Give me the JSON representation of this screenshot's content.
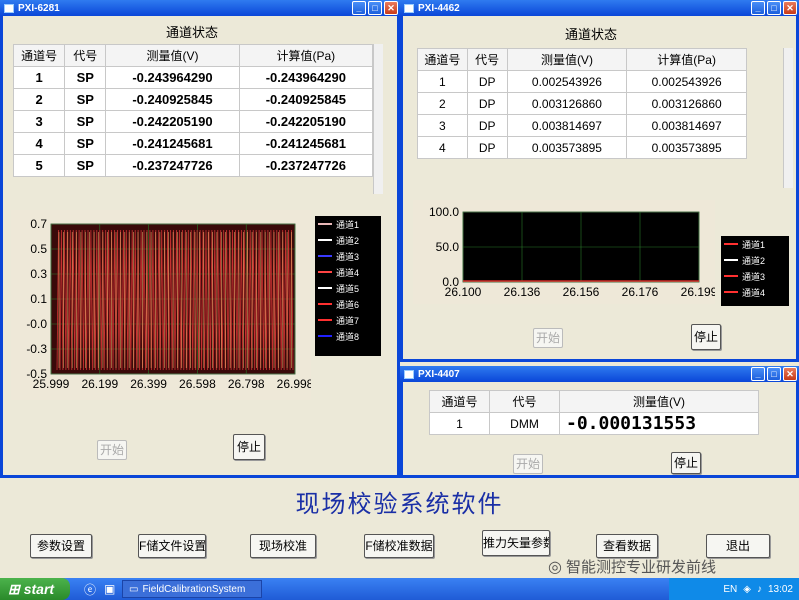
{
  "window1": {
    "title": "PXI-6281",
    "panel_title": "通道状态",
    "columns": [
      "通道号",
      "代号",
      "测量值(V)",
      "计算值(Pa)"
    ],
    "rows": [
      [
        "1",
        "SP",
        "-0.243964290",
        "-0.243964290"
      ],
      [
        "2",
        "SP",
        "-0.240925845",
        "-0.240925845"
      ],
      [
        "3",
        "SP",
        "-0.242205190",
        "-0.242205190"
      ],
      [
        "4",
        "SP",
        "-0.241245681",
        "-0.241245681"
      ],
      [
        "5",
        "SP",
        "-0.237247726",
        "-0.237247726"
      ]
    ],
    "start_label": "开始",
    "stop_label": "停止"
  },
  "window2": {
    "title": "PXI-4462",
    "panel_title": "通道状态",
    "columns": [
      "通道号",
      "代号",
      "测量值(V)",
      "计算值(Pa)"
    ],
    "rows": [
      [
        "1",
        "DP",
        "0.002543926",
        "0.002543926"
      ],
      [
        "2",
        "DP",
        "0.003126860",
        "0.003126860"
      ],
      [
        "3",
        "DP",
        "0.003814697",
        "0.003814697"
      ],
      [
        "4",
        "DP",
        "0.003573895",
        "0.003573895"
      ]
    ],
    "start_label": "开始",
    "stop_label": "停止"
  },
  "window3": {
    "title": "PXI-4407",
    "columns": [
      "通道号",
      "代号",
      "测量值(V)"
    ],
    "row": [
      "1",
      "DMM",
      "-0.000131553"
    ],
    "start_label": "开始",
    "stop_label": "停止"
  },
  "chart_data": [
    {
      "type": "line",
      "x_ticks": [
        "25.999",
        "26.199",
        "26.399",
        "26.598",
        "26.798",
        "26.998"
      ],
      "y_ticks": [
        "0.7",
        "0.5",
        "0.3",
        "0.1",
        "-0.0",
        "-0.3",
        "-0.5"
      ],
      "ylim": [
        -0.55,
        0.75
      ],
      "legend": [
        "通道1",
        "通道2",
        "通道3",
        "通道4",
        "通道5",
        "通道6",
        "通道7",
        "通道8"
      ],
      "legend_colors": [
        "#e8b8b8",
        "#ffffff",
        "#3a3aff",
        "#ff4444",
        "#ffffff",
        "#ff3030",
        "#ff3030",
        "#2020ff"
      ],
      "plot_bg": "#3a0a0a"
    },
    {
      "type": "line",
      "x_ticks": [
        "26.100",
        "26.136",
        "26.156",
        "26.176",
        "26.199"
      ],
      "y_ticks": [
        "100.0",
        "50.0",
        "0.0"
      ],
      "ylim": [
        0,
        100
      ],
      "legend": [
        "通道1",
        "通道2",
        "通道3",
        "通道4"
      ],
      "legend_colors": [
        "#ff3030",
        "#ffffff",
        "#ff3030",
        "#ff3030"
      ],
      "plot_bg": "#000000"
    }
  ],
  "main_title": "现场校验系统软件",
  "bottom_buttons": [
    "参数设置",
    "F储文件设置",
    "现场校准",
    "F储校准数据",
    "推力矢量参数",
    "查看数据",
    "退出"
  ],
  "taskbar": {
    "start_label": "start",
    "task_label": "FieldCalibrationSystem",
    "lang": "EN",
    "clock": "13:02"
  },
  "watermark": "智能测控专业研发前线"
}
